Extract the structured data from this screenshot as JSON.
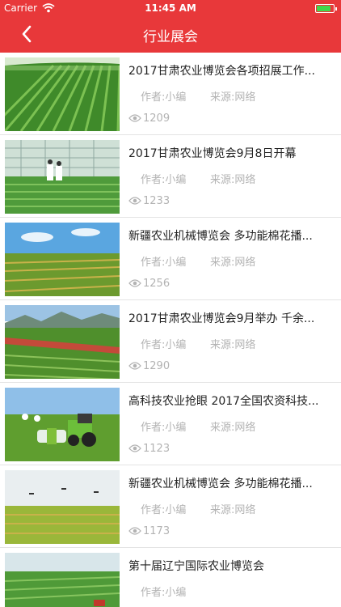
{
  "status_bar": {
    "carrier": "Carrier",
    "time": "11:45 AM",
    "battery_fraction": 0.85
  },
  "nav": {
    "title": "行业展会"
  },
  "articles": [
    {
      "title": "2017甘肃农业博览会各项招展工作...",
      "author": "作者:小编",
      "source": "来源:网络",
      "views": "1209"
    },
    {
      "title": "2017甘肃农业博览会9月8日开幕",
      "author": "作者:小编",
      "source": "来源:网络",
      "views": "1233"
    },
    {
      "title": "新疆农业机械博览会 多功能棉花播...",
      "author": "作者:小编",
      "source": "来源:网络",
      "views": "1256"
    },
    {
      "title": "2017甘肃农业博览会9月举办 千余...",
      "author": "作者:小编",
      "source": "来源:网络",
      "views": "1290"
    },
    {
      "title": "高科技农业抢眼 2017全国农资科技...",
      "author": "作者:小编",
      "source": "来源:网络",
      "views": "1123"
    },
    {
      "title": "新疆农业机械博览会 多功能棉花播...",
      "author": "作者:小编",
      "source": "来源:网络",
      "views": "1173"
    },
    {
      "title": "第十届辽宁国际农业博览会",
      "author": "作者:小编",
      "source": "",
      "views": ""
    }
  ],
  "colors": {
    "accent": "#e8383a",
    "battery": "#41d84a"
  },
  "icons": {
    "back": "chevron-left-icon",
    "views": "eye-icon",
    "wifi": "wifi-icon"
  }
}
